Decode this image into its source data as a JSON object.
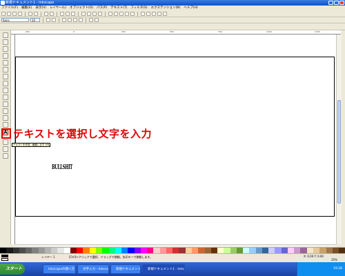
{
  "window": {
    "title": "新規ドキュメント1 - Inkscape"
  },
  "menu": [
    "ファイル(F)",
    "編集(E)",
    "表示(V)",
    "レイヤー(L)",
    "オブジェクト(O)",
    "パス(P)",
    "テキスト(T)",
    "フィルタ(S)",
    "エクステンション(N)",
    "ヘルプ(H)"
  ],
  "tool_controls": {
    "font_family": "Sans",
    "font_size": "10"
  },
  "annotation": {
    "text": "テキストを選択し文字を入力"
  },
  "tooltip": {
    "text": "テキストを作成、編集します (F8, T)"
  },
  "canvas": {
    "text": "BULLSHIT"
  },
  "ruler": {
    "labels": [
      "-250",
      "0",
      "250",
      "500",
      "750",
      "1000",
      "1250"
    ]
  },
  "status": {
    "layer": "レイヤー 1",
    "message": "[Ctrl]+クリックで選択、ドラッグで移動。矢印キーで移動します。",
    "coords": "X: 0.00 Y: 0.00",
    "zoom": "35%"
  },
  "taskbar": {
    "start": "スタート",
    "tasks": [
      "Inkscapeの使い方",
      "文字入力 - Inkscape",
      "新規ドキュメント",
      "新規ドキュメント1 - Inkscape"
    ],
    "clock": "19:28"
  },
  "colors": {
    "accent_red": "#e00000",
    "titlebar": "#0a4fcf"
  }
}
